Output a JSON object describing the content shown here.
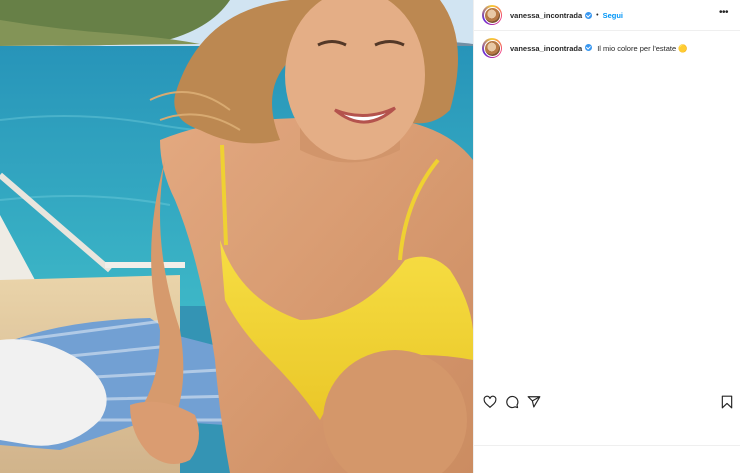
{
  "post": {
    "username": "vanessa_incontrada",
    "verified": true,
    "separator": "•",
    "follow_label": "Segui",
    "more_icon": "more-horizontal-icon",
    "caption": {
      "username": "vanessa_incontrada",
      "text": "Il mio colore per l'estate",
      "emoji": "🟡"
    }
  },
  "actions": {
    "icons": [
      "heart-icon",
      "comment-icon",
      "share-icon",
      "bookmark-icon"
    ]
  },
  "colors": {
    "link_blue": "#0095f6",
    "verified_blue": "#3897f0",
    "text": "#262626",
    "swimsuit_yellow": "#f2d12a",
    "sea": "#1f93b4"
  }
}
